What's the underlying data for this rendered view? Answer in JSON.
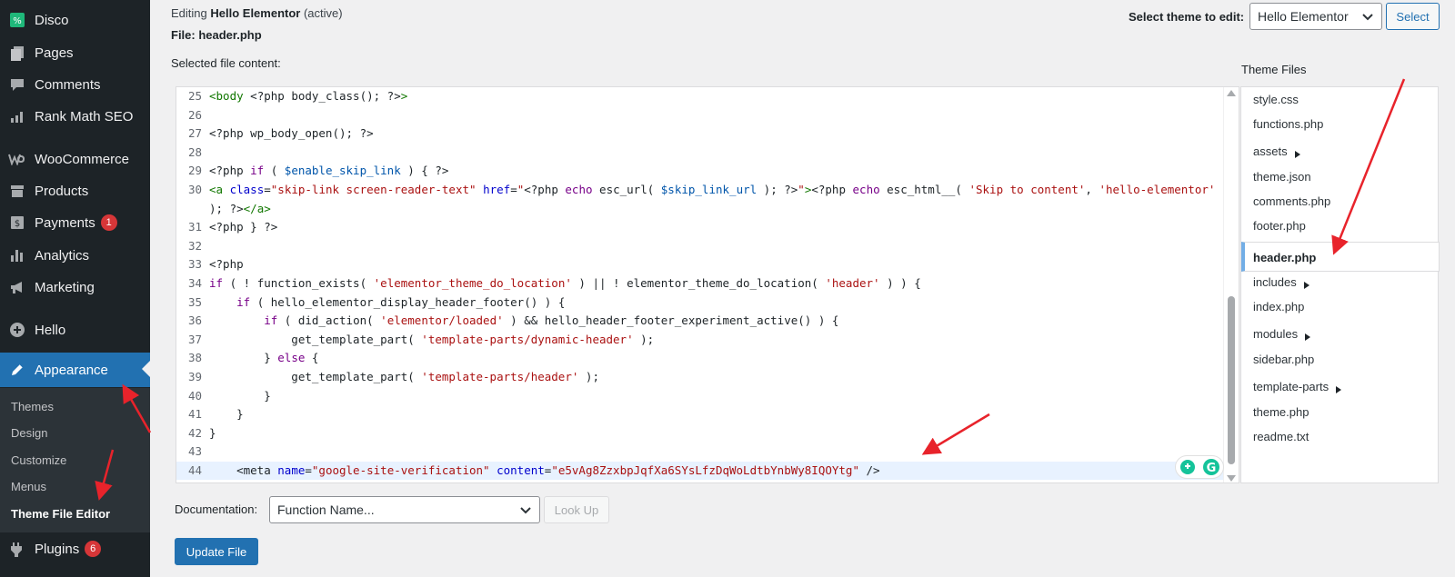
{
  "sidebar": {
    "items": [
      {
        "label": "Disco",
        "icon": "disco-icon"
      },
      {
        "label": "Pages",
        "icon": "pages-icon"
      },
      {
        "label": "Comments",
        "icon": "comments-icon"
      },
      {
        "label": "Rank Math SEO",
        "icon": "rank-math-icon"
      },
      {
        "label": "WooCommerce",
        "icon": "woocommerce-icon"
      },
      {
        "label": "Products",
        "icon": "products-icon"
      },
      {
        "label": "Payments",
        "icon": "payments-icon",
        "badge": "1"
      },
      {
        "label": "Analytics",
        "icon": "analytics-icon"
      },
      {
        "label": "Marketing",
        "icon": "marketing-icon"
      },
      {
        "label": "Hello",
        "icon": "hello-icon"
      },
      {
        "label": "Appearance",
        "icon": "appearance-icon"
      },
      {
        "label": "Plugins",
        "icon": "plugins-icon",
        "badge": "6"
      }
    ],
    "submenu": [
      "Themes",
      "Design",
      "Customize",
      "Menus",
      "Theme File Editor"
    ]
  },
  "header": {
    "editing_prefix": "Editing",
    "theme_name": "Hello Elementor",
    "active_suffix": "(active)",
    "file_line": "File: header.php",
    "selected_label": "Selected file content:",
    "theme_select_label": "Select theme to edit:",
    "theme_select_value": "Hello Elementor",
    "select_button": "Select"
  },
  "editor": {
    "lines": [
      {
        "n": "25",
        "html": "<span class=\"t\">&lt;body</span> &lt;?php body_class(); ?&gt;<span class=\"t\">&gt;</span>"
      },
      {
        "n": "26",
        "html": ""
      },
      {
        "n": "27",
        "html": "&lt;?php wp_body_open(); ?&gt;"
      },
      {
        "n": "28",
        "html": ""
      },
      {
        "n": "29",
        "html": "&lt;?php <span class=\"k\">if</span> ( <span class=\"v\">$enable_skip_link</span> ) { ?&gt;"
      },
      {
        "n": "30",
        "html": "<span class=\"t\">&lt;a</span> <span class=\"a\">class</span>=<span class=\"s\">\"skip-link screen-reader-text\"</span> <span class=\"a\">href</span>=<span class=\"s\">\"</span>&lt;?php <span class=\"k\">echo</span> esc_url( <span class=\"v\">$skip_link_url</span> ); ?&gt;<span class=\"s\">\"</span><span class=\"t\">&gt;</span>&lt;?php <span class=\"k\">echo</span> esc_html__( <span class=\"s\">'Skip to content'</span>, <span class=\"s\">'hello-elementor'</span>"
      },
      {
        "n": "",
        "html": "); ?&gt;<span class=\"t\">&lt;/a&gt;</span>"
      },
      {
        "n": "31",
        "html": "&lt;?php } ?&gt;"
      },
      {
        "n": "32",
        "html": ""
      },
      {
        "n": "33",
        "html": "&lt;?php"
      },
      {
        "n": "34",
        "html": "<span class=\"k\">if</span> ( ! function_exists( <span class=\"s\">'elementor_theme_do_location'</span> ) || ! elementor_theme_do_location( <span class=\"s\">'header'</span> ) ) {"
      },
      {
        "n": "35",
        "html": "    <span class=\"k\">if</span> ( hello_elementor_display_header_footer() ) {"
      },
      {
        "n": "36",
        "html": "        <span class=\"k\">if</span> ( did_action( <span class=\"s\">'elementor/loaded'</span> ) &amp;&amp; hello_header_footer_experiment_active() ) {"
      },
      {
        "n": "37",
        "html": "            get_template_part( <span class=\"s\">'template-parts/dynamic-header'</span> );"
      },
      {
        "n": "38",
        "html": "        } <span class=\"k\">else</span> {"
      },
      {
        "n": "39",
        "html": "            get_template_part( <span class=\"s\">'template-parts/header'</span> );"
      },
      {
        "n": "40",
        "html": "        }"
      },
      {
        "n": "41",
        "html": "    }"
      },
      {
        "n": "42",
        "html": "}"
      },
      {
        "n": "43",
        "html": ""
      },
      {
        "n": "44",
        "html": "    &lt;meta <span class=\"a\">name</span>=<span class=\"s\">\"google-site-verification\"</span> <span class=\"a\">content</span>=<span class=\"s\">\"e5vAg8ZzxbpJqfXa6SYsLfzDqWoLdtbYnbWy8IQOYtg\"</span> /&gt;"
      }
    ]
  },
  "theme_files": {
    "title": "Theme Files",
    "items": [
      {
        "label": "style.css",
        "folder": false
      },
      {
        "label": "functions.php",
        "folder": false
      },
      {
        "label": "assets",
        "folder": true
      },
      {
        "label": "theme.json",
        "folder": false
      },
      {
        "label": "comments.php",
        "folder": false
      },
      {
        "label": "footer.php",
        "folder": false
      },
      {
        "label": "header.php",
        "folder": false,
        "active": true
      },
      {
        "label": "includes",
        "folder": true
      },
      {
        "label": "index.php",
        "folder": false
      },
      {
        "label": "modules",
        "folder": true
      },
      {
        "label": "sidebar.php",
        "folder": false
      },
      {
        "label": "template-parts",
        "folder": true
      },
      {
        "label": "theme.php",
        "folder": false
      },
      {
        "label": "readme.txt",
        "folder": false
      }
    ]
  },
  "documentation": {
    "label": "Documentation:",
    "select_value": "Function Name...",
    "lookup_button": "Look Up"
  },
  "update_button": "Update File",
  "colors": {
    "accent": "#2271b1",
    "annotation_arrow": "#e8232b",
    "badge": "#d63638",
    "sidebar_bg": "#1d2327"
  }
}
